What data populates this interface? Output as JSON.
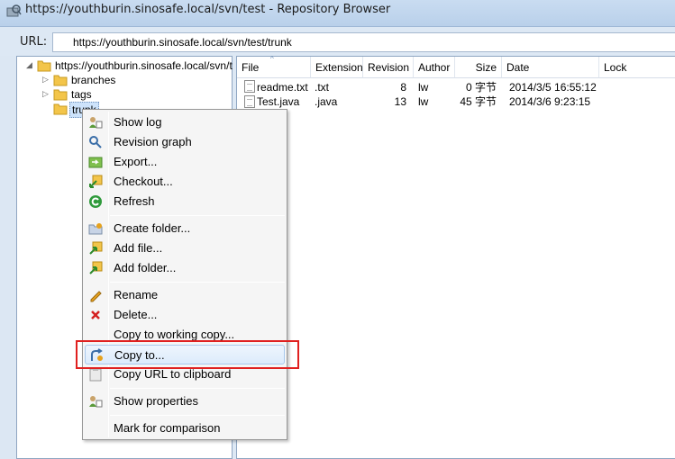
{
  "window": {
    "title": "https://youthburin.sinosafe.local/svn/test - Repository Browser",
    "icon": "repo-browser-icon"
  },
  "url_bar": {
    "label": "URL:",
    "value": "https://youthburin.sinosafe.local/svn/test/trunk"
  },
  "tree": {
    "root": "https://youthburin.sinosafe.local/svn/te",
    "children": [
      "branches",
      "tags",
      "trunk"
    ],
    "selected": "trunk"
  },
  "file_list": {
    "columns": [
      "File",
      "Extension",
      "Revision",
      "Author",
      "Size",
      "Date",
      "Lock"
    ],
    "rows": [
      {
        "file": "readme.txt",
        "extension": ".txt",
        "revision": "8",
        "author": "lw",
        "size": "0 字节",
        "date": "2014/3/5 16:55:12",
        "lock": ""
      },
      {
        "file": "Test.java",
        "extension": ".java",
        "revision": "13",
        "author": "lw",
        "size": "45 字节",
        "date": "2014/3/6 9:23:15",
        "lock": ""
      }
    ]
  },
  "context_menu": {
    "items": [
      {
        "label": "Show log",
        "icon": "show-log-icon"
      },
      {
        "label": "Revision graph",
        "icon": "revision-graph-icon"
      },
      {
        "label": "Export...",
        "icon": "export-icon"
      },
      {
        "label": "Checkout...",
        "icon": "checkout-icon"
      },
      {
        "label": "Refresh",
        "icon": "refresh-icon"
      },
      {
        "label": "Create folder...",
        "icon": "create-folder-icon"
      },
      {
        "label": "Add file...",
        "icon": "add-file-icon"
      },
      {
        "label": "Add folder...",
        "icon": "add-folder-icon"
      },
      {
        "label": "Rename",
        "icon": "rename-icon"
      },
      {
        "label": "Delete...",
        "icon": "delete-icon"
      },
      {
        "label": "Copy to working copy...",
        "icon": ""
      },
      {
        "label": "Copy to...",
        "icon": "copy-to-icon"
      },
      {
        "label": "Copy URL to clipboard",
        "icon": "copy-url-icon"
      },
      {
        "label": "Show properties",
        "icon": "show-properties-icon"
      },
      {
        "label": "Mark for comparison",
        "icon": ""
      }
    ],
    "hovered": "Copy to...",
    "highlight_color": "#e0201f"
  }
}
